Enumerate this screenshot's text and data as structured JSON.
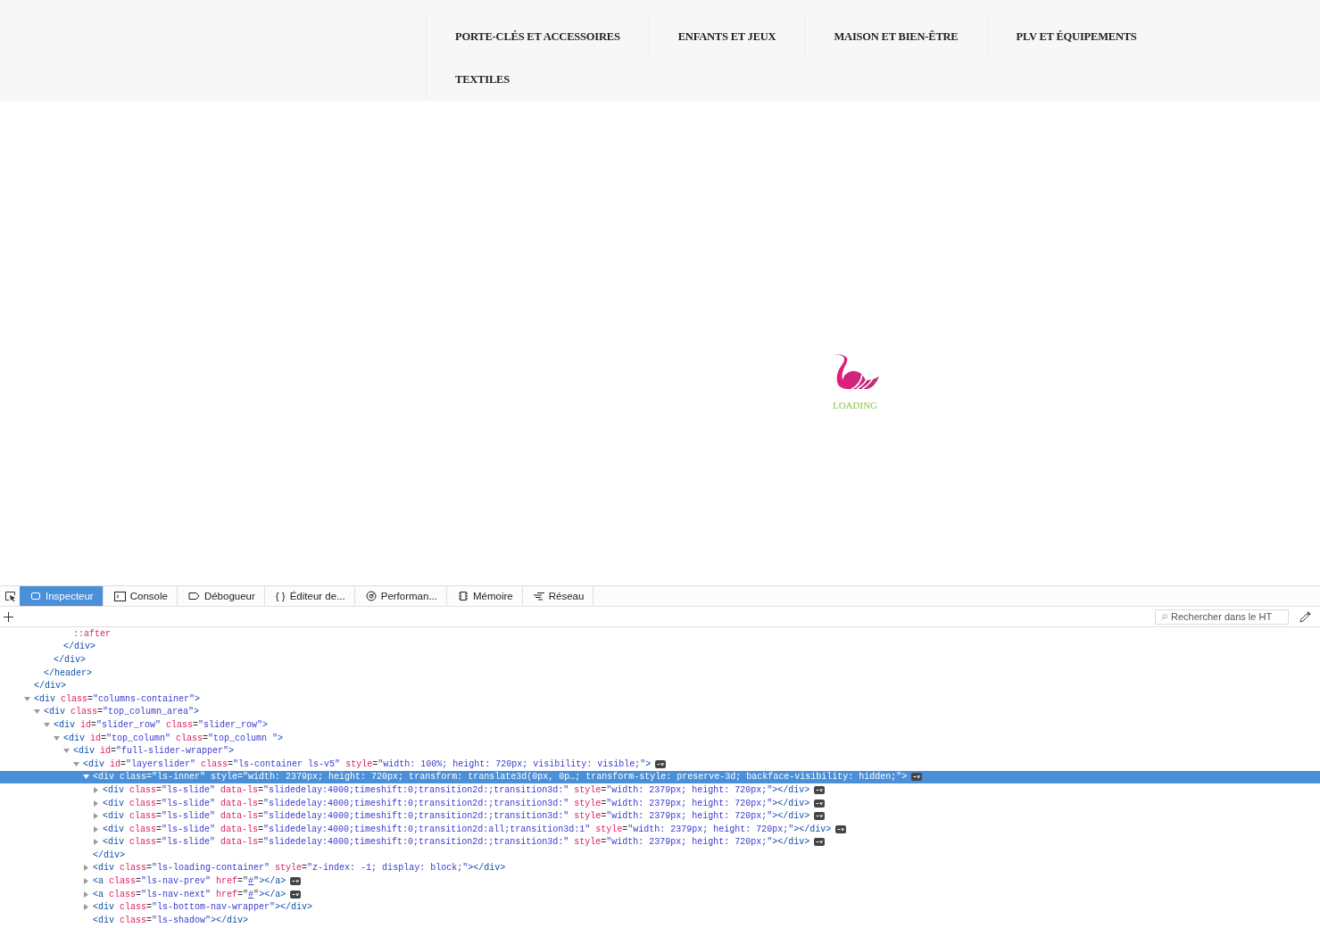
{
  "nav": {
    "items": [
      {
        "label": "PORTE-CLÉS ET ACCESSOIRES"
      },
      {
        "label": "ENFANTS ET JEUX"
      },
      {
        "label": "MAISON ET BIEN-ÊTRE"
      },
      {
        "label": "PLV ET ÉQUIPEMENTS"
      },
      {
        "label": "TEXTILES"
      }
    ]
  },
  "loader": {
    "label": "LOADING"
  },
  "devtools": {
    "tabs": [
      {
        "label": "Inspecteur",
        "selected": true
      },
      {
        "label": "Console",
        "selected": false
      },
      {
        "label": "Débogueur",
        "selected": false
      },
      {
        "label": "Éditeur de...",
        "glyph": "{ }",
        "selected": false
      },
      {
        "label": "Performan...",
        "selected": false
      },
      {
        "label": "Mémoire",
        "selected": false
      },
      {
        "label": "Réseau",
        "selected": false
      }
    ],
    "search": {
      "placeholder": "Rechercher dans le HT"
    },
    "nodes": [
      {
        "close": "</div>",
        "children": [
          {
            "close": "</header>",
            "children": [
              {
                "close": "</div>",
                "children": [
                  {
                    "close": "</div>",
                    "children": [
                      {
                        "selected": false,
                        "events": false,
                        "parts": [
                          {
                            "kind": "pseudo",
                            "text": "::after"
                          }
                        ]
                      }
                    ]
                  }
                ]
              }
            ]
          }
        ]
      },
      {
        "expanded": true,
        "selected": false,
        "events": false,
        "parts": [
          {
            "kind": "tag",
            "text": "<div"
          },
          {
            "kind": "attr",
            "text": "class"
          },
          {
            "kind": "eq",
            "text": "="
          },
          {
            "kind": "value",
            "text": "\"columns-container\""
          },
          {
            "kind": "tag",
            "text": ">"
          }
        ],
        "children": [
          {
            "expanded": true,
            "selected": false,
            "events": false,
            "parts": [
              {
                "kind": "tag",
                "text": "<div"
              },
              {
                "kind": "attr",
                "text": "class"
              },
              {
                "kind": "eq",
                "text": "="
              },
              {
                "kind": "value",
                "text": "\"top_column_area\""
              },
              {
                "kind": "tag",
                "text": ">"
              }
            ],
            "children": [
              {
                "expanded": true,
                "selected": false,
                "events": false,
                "parts": [
                  {
                    "kind": "tag",
                    "text": "<div"
                  },
                  {
                    "kind": "attr",
                    "text": "id"
                  },
                  {
                    "kind": "eq",
                    "text": "="
                  },
                  {
                    "kind": "value",
                    "text": "\"slider_row\""
                  },
                  {
                    "kind": "attr",
                    "text": "class"
                  },
                  {
                    "kind": "eq",
                    "text": "="
                  },
                  {
                    "kind": "value",
                    "text": "\"slider_row\""
                  },
                  {
                    "kind": "tag",
                    "text": ">"
                  }
                ],
                "children": [
                  {
                    "expanded": true,
                    "selected": false,
                    "events": false,
                    "parts": [
                      {
                        "kind": "tag",
                        "text": "<div"
                      },
                      {
                        "kind": "attr",
                        "text": "id"
                      },
                      {
                        "kind": "eq",
                        "text": "="
                      },
                      {
                        "kind": "value",
                        "text": "\"top_column\""
                      },
                      {
                        "kind": "attr",
                        "text": "class"
                      },
                      {
                        "kind": "eq",
                        "text": "="
                      },
                      {
                        "kind": "value",
                        "text": "\"top_column \""
                      },
                      {
                        "kind": "tag",
                        "text": ">"
                      }
                    ],
                    "children": [
                      {
                        "expanded": true,
                        "selected": false,
                        "events": false,
                        "parts": [
                          {
                            "kind": "tag",
                            "text": "<div"
                          },
                          {
                            "kind": "attr",
                            "text": "id"
                          },
                          {
                            "kind": "eq",
                            "text": "="
                          },
                          {
                            "kind": "value",
                            "text": "\"full-slider-wrapper\""
                          },
                          {
                            "kind": "tag",
                            "text": ">"
                          }
                        ],
                        "children": [
                          {
                            "expanded": true,
                            "selected": false,
                            "events": true,
                            "parts": [
                              {
                                "kind": "tag",
                                "text": "<div"
                              },
                              {
                                "kind": "attr",
                                "text": "id"
                              },
                              {
                                "kind": "eq",
                                "text": "="
                              },
                              {
                                "kind": "value",
                                "text": "\"layerslider\""
                              },
                              {
                                "kind": "attr",
                                "text": "class"
                              },
                              {
                                "kind": "eq",
                                "text": "="
                              },
                              {
                                "kind": "value",
                                "text": "\"ls-container ls-v5\""
                              },
                              {
                                "kind": "attr",
                                "text": "style"
                              },
                              {
                                "kind": "eq",
                                "text": "="
                              },
                              {
                                "kind": "value",
                                "text": "\"width: 100%; height: 720px; visibility: visible;\""
                              },
                              {
                                "kind": "tag",
                                "text": ">"
                              }
                            ],
                            "children": [
                              {
                                "expanded": true,
                                "selected": true,
                                "events": true,
                                "close": "</div>",
                                "parts": [
                                  {
                                    "kind": "tag",
                                    "text": "<div"
                                  },
                                  {
                                    "kind": "attr",
                                    "text": "class"
                                  },
                                  {
                                    "kind": "eq",
                                    "text": "="
                                  },
                                  {
                                    "kind": "value",
                                    "text": "\"ls-inner\""
                                  },
                                  {
                                    "kind": "attr",
                                    "text": "style"
                                  },
                                  {
                                    "kind": "eq",
                                    "text": "="
                                  },
                                  {
                                    "kind": "value",
                                    "text": "\"width: 2379px; height: 720px; transform: translate3d(0px, 0p…; transform-style: preserve-3d; backface-visibility: hidden;\""
                                  },
                                  {
                                    "kind": "tag",
                                    "text": ">"
                                  }
                                ],
                                "children": [
                                  {
                                    "expanded": false,
                                    "selected": false,
                                    "events": true,
                                    "parts": [
                                      {
                                        "kind": "tag",
                                        "text": "<div"
                                      },
                                      {
                                        "kind": "attr",
                                        "text": "class"
                                      },
                                      {
                                        "kind": "eq",
                                        "text": "="
                                      },
                                      {
                                        "kind": "value",
                                        "text": "\"ls-slide\""
                                      },
                                      {
                                        "kind": "attr",
                                        "text": "data-ls"
                                      },
                                      {
                                        "kind": "eq",
                                        "text": "="
                                      },
                                      {
                                        "kind": "value",
                                        "text": "\"slidedelay:4000;timeshift:0;transition2d:;transition3d:\""
                                      },
                                      {
                                        "kind": "attr",
                                        "text": "style"
                                      },
                                      {
                                        "kind": "eq",
                                        "text": "="
                                      },
                                      {
                                        "kind": "value",
                                        "text": "\"width: 2379px; height: 720px;\""
                                      },
                                      {
                                        "kind": "tag",
                                        "text": "></div>"
                                      }
                                    ]
                                  },
                                  {
                                    "expanded": false,
                                    "selected": false,
                                    "events": true,
                                    "parts": [
                                      {
                                        "kind": "tag",
                                        "text": "<div"
                                      },
                                      {
                                        "kind": "attr",
                                        "text": "class"
                                      },
                                      {
                                        "kind": "eq",
                                        "text": "="
                                      },
                                      {
                                        "kind": "value",
                                        "text": "\"ls-slide\""
                                      },
                                      {
                                        "kind": "attr",
                                        "text": "data-ls"
                                      },
                                      {
                                        "kind": "eq",
                                        "text": "="
                                      },
                                      {
                                        "kind": "value",
                                        "text": "\"slidedelay:4000;timeshift:0;transition2d:;transition3d:\""
                                      },
                                      {
                                        "kind": "attr",
                                        "text": "style"
                                      },
                                      {
                                        "kind": "eq",
                                        "text": "="
                                      },
                                      {
                                        "kind": "value",
                                        "text": "\"width: 2379px; height: 720px;\""
                                      },
                                      {
                                        "kind": "tag",
                                        "text": "></div>"
                                      }
                                    ]
                                  },
                                  {
                                    "expanded": false,
                                    "selected": false,
                                    "events": true,
                                    "parts": [
                                      {
                                        "kind": "tag",
                                        "text": "<div"
                                      },
                                      {
                                        "kind": "attr",
                                        "text": "class"
                                      },
                                      {
                                        "kind": "eq",
                                        "text": "="
                                      },
                                      {
                                        "kind": "value",
                                        "text": "\"ls-slide\""
                                      },
                                      {
                                        "kind": "attr",
                                        "text": "data-ls"
                                      },
                                      {
                                        "kind": "eq",
                                        "text": "="
                                      },
                                      {
                                        "kind": "value",
                                        "text": "\"slidedelay:4000;timeshift:0;transition2d:;transition3d:\""
                                      },
                                      {
                                        "kind": "attr",
                                        "text": "style"
                                      },
                                      {
                                        "kind": "eq",
                                        "text": "="
                                      },
                                      {
                                        "kind": "value",
                                        "text": "\"width: 2379px; height: 720px;\""
                                      },
                                      {
                                        "kind": "tag",
                                        "text": "></div>"
                                      }
                                    ]
                                  },
                                  {
                                    "expanded": false,
                                    "selected": false,
                                    "events": true,
                                    "parts": [
                                      {
                                        "kind": "tag",
                                        "text": "<div"
                                      },
                                      {
                                        "kind": "attr",
                                        "text": "class"
                                      },
                                      {
                                        "kind": "eq",
                                        "text": "="
                                      },
                                      {
                                        "kind": "value",
                                        "text": "\"ls-slide\""
                                      },
                                      {
                                        "kind": "attr",
                                        "text": "data-ls"
                                      },
                                      {
                                        "kind": "eq",
                                        "text": "="
                                      },
                                      {
                                        "kind": "value",
                                        "text": "\"slidedelay:4000;timeshift:0;transition2d:all;transition3d:1\""
                                      },
                                      {
                                        "kind": "attr",
                                        "text": "style"
                                      },
                                      {
                                        "kind": "eq",
                                        "text": "="
                                      },
                                      {
                                        "kind": "value",
                                        "text": "\"width: 2379px; height: 720px;\""
                                      },
                                      {
                                        "kind": "tag",
                                        "text": "></div>"
                                      }
                                    ]
                                  },
                                  {
                                    "expanded": false,
                                    "selected": false,
                                    "events": true,
                                    "parts": [
                                      {
                                        "kind": "tag",
                                        "text": "<div"
                                      },
                                      {
                                        "kind": "attr",
                                        "text": "class"
                                      },
                                      {
                                        "kind": "eq",
                                        "text": "="
                                      },
                                      {
                                        "kind": "value",
                                        "text": "\"ls-slide\""
                                      },
                                      {
                                        "kind": "attr",
                                        "text": "data-ls"
                                      },
                                      {
                                        "kind": "eq",
                                        "text": "="
                                      },
                                      {
                                        "kind": "value",
                                        "text": "\"slidedelay:4000;timeshift:0;transition2d:;transition3d:\""
                                      },
                                      {
                                        "kind": "attr",
                                        "text": "style"
                                      },
                                      {
                                        "kind": "eq",
                                        "text": "="
                                      },
                                      {
                                        "kind": "value",
                                        "text": "\"width: 2379px; height: 720px;\""
                                      },
                                      {
                                        "kind": "tag",
                                        "text": "></div>"
                                      }
                                    ]
                                  }
                                ]
                              },
                              {
                                "expanded": false,
                                "selected": false,
                                "events": false,
                                "parts": [
                                  {
                                    "kind": "tag",
                                    "text": "<div"
                                  },
                                  {
                                    "kind": "attr",
                                    "text": "class"
                                  },
                                  {
                                    "kind": "eq",
                                    "text": "="
                                  },
                                  {
                                    "kind": "value",
                                    "text": "\"ls-loading-container\""
                                  },
                                  {
                                    "kind": "attr",
                                    "text": "style"
                                  },
                                  {
                                    "kind": "eq",
                                    "text": "="
                                  },
                                  {
                                    "kind": "value",
                                    "text": "\"z-index: -1; display: block;\""
                                  },
                                  {
                                    "kind": "tag",
                                    "text": "></div>"
                                  }
                                ]
                              },
                              {
                                "expanded": false,
                                "selected": false,
                                "events": true,
                                "parts": [
                                  {
                                    "kind": "tag",
                                    "text": "<a"
                                  },
                                  {
                                    "kind": "attr",
                                    "text": "class"
                                  },
                                  {
                                    "kind": "eq",
                                    "text": "="
                                  },
                                  {
                                    "kind": "value",
                                    "text": "\"ls-nav-prev\""
                                  },
                                  {
                                    "kind": "attr",
                                    "text": "href"
                                  },
                                  {
                                    "kind": "eq",
                                    "text": "=\""
                                  },
                                  {
                                    "kind": "link",
                                    "text": "#"
                                  },
                                  {
                                    "kind": "eq",
                                    "text": "\""
                                  },
                                  {
                                    "kind": "tag",
                                    "text": "></a>"
                                  }
                                ]
                              },
                              {
                                "expanded": false,
                                "selected": false,
                                "events": true,
                                "parts": [
                                  {
                                    "kind": "tag",
                                    "text": "<a"
                                  },
                                  {
                                    "kind": "attr",
                                    "text": "class"
                                  },
                                  {
                                    "kind": "eq",
                                    "text": "="
                                  },
                                  {
                                    "kind": "value",
                                    "text": "\"ls-nav-next\""
                                  },
                                  {
                                    "kind": "attr",
                                    "text": "href"
                                  },
                                  {
                                    "kind": "eq",
                                    "text": "=\""
                                  },
                                  {
                                    "kind": "link",
                                    "text": "#"
                                  },
                                  {
                                    "kind": "eq",
                                    "text": "\""
                                  },
                                  {
                                    "kind": "tag",
                                    "text": "></a>"
                                  }
                                ]
                              },
                              {
                                "expanded": false,
                                "selected": false,
                                "events": false,
                                "parts": [
                                  {
                                    "kind": "tag",
                                    "text": "<div"
                                  },
                                  {
                                    "kind": "attr",
                                    "text": "class"
                                  },
                                  {
                                    "kind": "eq",
                                    "text": "="
                                  },
                                  {
                                    "kind": "value",
                                    "text": "\"ls-bottom-nav-wrapper\""
                                  },
                                  {
                                    "kind": "tag",
                                    "text": "></div>"
                                  }
                                ]
                              },
                              {
                                "selected": false,
                                "events": false,
                                "parts": [
                                  {
                                    "kind": "tag",
                                    "text": "<div"
                                  },
                                  {
                                    "kind": "attr",
                                    "text": "class"
                                  },
                                  {
                                    "kind": "eq",
                                    "text": "="
                                  },
                                  {
                                    "kind": "value",
                                    "text": "\"ls-shadow\""
                                  },
                                  {
                                    "kind": "tag",
                                    "text": "></div>"
                                  }
                                ]
                              }
                            ]
                          }
                        ]
                      }
                    ]
                  }
                ]
              }
            ]
          }
        ]
      }
    ]
  }
}
